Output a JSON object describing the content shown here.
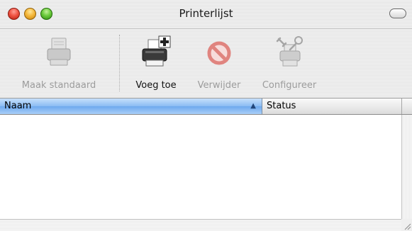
{
  "window": {
    "title": "Printerlijst"
  },
  "toolbar": {
    "buttons": [
      {
        "label": "Maak standaard",
        "icon": "printer-default-icon",
        "enabled": false
      },
      {
        "label": "Voeg toe",
        "icon": "printer-add-icon",
        "enabled": true
      },
      {
        "label": "Verwijder",
        "icon": "delete-prohibited-icon",
        "enabled": false
      },
      {
        "label": "Configureer",
        "icon": "printer-configure-icon",
        "enabled": false
      }
    ]
  },
  "table": {
    "columns": [
      {
        "label": "Naam",
        "sorted": true,
        "sort_direction": "ascending"
      },
      {
        "label": "Status",
        "sorted": false
      }
    ],
    "rows": []
  },
  "colors": {
    "selected_column_header": "#8bbcf3",
    "close_button": "#f05545",
    "minimize_button": "#f5b93d",
    "zoom_button": "#6ccb3d",
    "delete_icon": "#e0847f"
  }
}
